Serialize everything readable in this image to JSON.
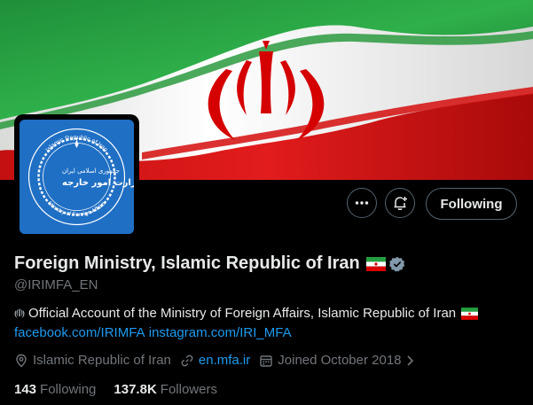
{
  "banner": {
    "description_icon": "iran-flag-banner"
  },
  "avatar": {
    "logo_text_top": "Islamic Republic of Iran",
    "logo_text_bottom": "Ministry of Foreign Affairs",
    "logo_text_fa1": "جمهوری اسلامی ایران",
    "logo_text_fa2": "وزارت امور خارجه"
  },
  "actions": {
    "more_icon": "more-icon",
    "notify_icon": "bell-plus-icon",
    "following_label": "Following"
  },
  "profile": {
    "name": "Foreign Ministry, Islamic Republic of Iran",
    "handle": "@IRIMFA_EN",
    "bio_text": "Official Account of the Ministry of Foreign Affairs, Islamic Republic of Iran",
    "bio_links": [
      "facebook.com/IRIMFA",
      "instagram.com/IRI_MFA"
    ],
    "location": "Islamic Republic of Iran",
    "website": "en.mfa.ir",
    "joined": "Joined October 2018",
    "following_count": "143",
    "following_label": "Following",
    "followers_count": "137.8K",
    "followers_label": "Followers"
  },
  "colors": {
    "link": "#1d9bf0",
    "muted": "#71767b",
    "text": "#e7e9ea",
    "flag_green": "#239f40",
    "flag_red": "#da0000"
  }
}
